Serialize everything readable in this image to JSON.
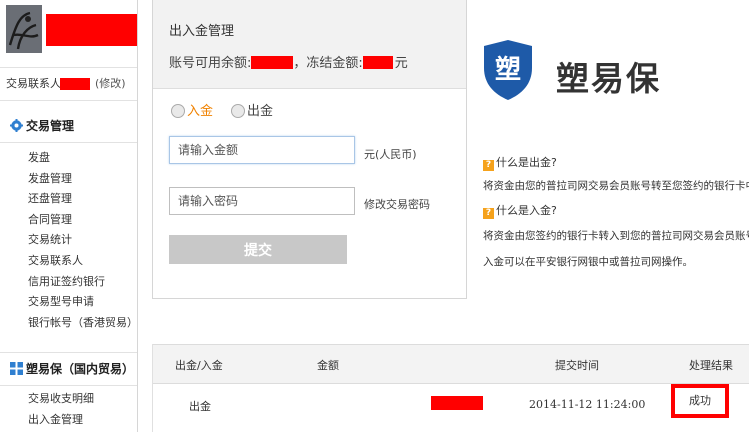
{
  "sidebar": {
    "contact_label": "交易联系人:",
    "contact_edit": "(修改)",
    "trade_section_title": "交易管理",
    "trade_items": [
      {
        "label": "发盘"
      },
      {
        "label": "发盘管理"
      },
      {
        "label": "还盘管理"
      },
      {
        "label": "合同管理"
      },
      {
        "label": "交易统计"
      },
      {
        "label": "交易联系人"
      },
      {
        "label": "信用证签约银行"
      },
      {
        "label": "交易型号申请"
      },
      {
        "label": "银行帐号（香港贸易）"
      }
    ],
    "suyibao_section_title": "塑易保（国内贸易）",
    "suyibao_items": [
      {
        "label": "交易收支明细"
      },
      {
        "label": "出入金管理"
      }
    ]
  },
  "panel": {
    "title": "出入金管理",
    "balance_label": "账号可用余额:",
    "frozen_label": "，冻结金额:",
    "currency_suffix": "元",
    "radio_in": "入金",
    "radio_out": "出金",
    "amount_placeholder": "请输入金额",
    "amount_unit": "元(人民币)",
    "password_placeholder": "请输入密码",
    "password_hint": "修改交易密码",
    "submit_label": "提交"
  },
  "info": {
    "logo_char": "塑",
    "brand_name": "塑易保",
    "q1": "什么是出金?",
    "a1": "将资金由您的普拉司网交易会员账号转至您签约的银行卡中。",
    "q2": "什么是入金?",
    "a2": "将资金由您签约的银行卡转入到您的普拉司网交易会员账号下。",
    "a3": "入金可以在平安银行网银中或普拉司网操作。",
    "q_icon": "?"
  },
  "table": {
    "headers": {
      "type": "出金/入金",
      "amount": "金额",
      "time": "提交时间",
      "result": "处理结果"
    },
    "rows": [
      {
        "type": "出金",
        "time": "2014-11-12 11:24:00",
        "result": "成功"
      }
    ]
  },
  "colors": {
    "accent_orange": "#f08200",
    "brand_blue": "#1e5aa8",
    "redaction": "#ff0000",
    "highlight_border": "#ff0000"
  }
}
